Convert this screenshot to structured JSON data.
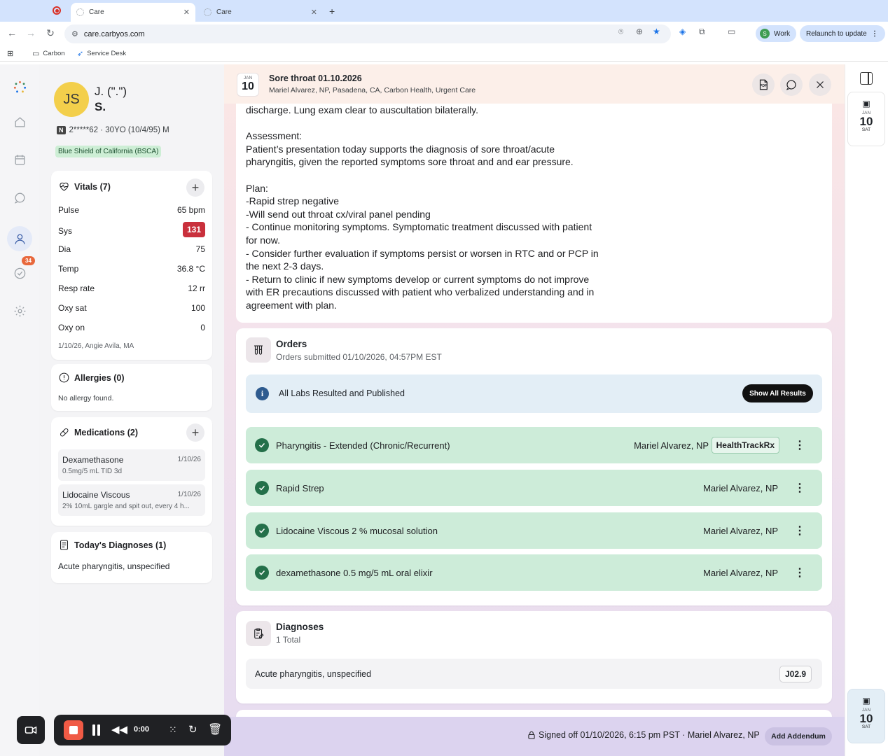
{
  "browser": {
    "tabs": [
      {
        "label": "Care"
      },
      {
        "label": "Care"
      }
    ],
    "url": "care.carbyos.com",
    "profile_initial": "S",
    "profile_label": "Work",
    "relaunch_label": "Relaunch to update",
    "bookmarks": [
      {
        "label": "Carbon"
      },
      {
        "label": "Service Desk"
      }
    ]
  },
  "sidebar": {
    "badge_count": "34"
  },
  "patient": {
    "initials": "JS",
    "name_line1": "J. (\".\")",
    "name_line2": "S.",
    "id_badge": "N",
    "id_line": "2*****62 · 30YO (10/4/95) M",
    "insurance": "Blue Shield of California (BSCA)"
  },
  "vitals": {
    "title": "Vitals (7)",
    "rows": [
      {
        "label": "Pulse",
        "value": "65 bpm"
      },
      {
        "label": "Sys",
        "value": "131"
      },
      {
        "label": "Dia",
        "value": "75"
      },
      {
        "label": "Temp",
        "value": "36.8 °C"
      },
      {
        "label": "Resp rate",
        "value": "12 rr"
      },
      {
        "label": "Oxy sat",
        "value": "100"
      },
      {
        "label": "Oxy on",
        "value": "0"
      }
    ],
    "footer": "1/10/26, Angie Avila, MA"
  },
  "allergies": {
    "title": "Allergies (0)",
    "empty": "No allergy found."
  },
  "medications": {
    "title": "Medications (2)",
    "items": [
      {
        "name": "Dexamethasone",
        "date": "1/10/26",
        "detail": "0.5mg/5 mL TID 3d"
      },
      {
        "name": "Lidocaine Viscous",
        "date": "1/10/26",
        "detail": "2% 10mL gargle and spit out, every 4 h..."
      }
    ]
  },
  "diagnoses_today": {
    "title": "Today's Diagnoses (1)",
    "item": "Acute pharyngitis, unspecified"
  },
  "encounter": {
    "month": "JAN",
    "day": "10",
    "title": "Sore throat 01.10.2026",
    "subtitle": "Mariel Alvarez, NP, Pasadena, CA, Carbon Health, Urgent Care",
    "pdf_label": "PDF"
  },
  "note": {
    "lines": [
      "discharge. Lung exam clear to auscultation bilaterally.",
      "",
      "Assessment:",
      "Patient’s presentation today supports the diagnosis of sore throat/acute",
      "pharyngitis, given the reported symptoms sore throat and and ear pressure.",
      "",
      "Plan:",
      "-Rapid strep negative",
      "-Will send out throat cx/viral panel pending",
      "- Continue monitoring symptoms. Symptomatic treatment discussed with patient",
      "for now.",
      "- Consider further evaluation if symptoms persist or worsen in RTC and or PCP in",
      "the next 2-3 days.",
      "- Return to clinic if new symptoms develop or current symptoms do not improve",
      "with ER precautions discussed with patient who verbalized understanding and in",
      "agreement with plan."
    ]
  },
  "orders": {
    "title": "Orders",
    "subtitle": "Orders submitted 01/10/2026, 04:57PM EST",
    "banner": "All Labs Resulted and Published",
    "show_all": "Show All Results",
    "items": [
      {
        "name": "Pharyngitis - Extended (Chronic/Recurrent)",
        "provider": "Mariel Alvarez, NP",
        "tag": "HealthTrackRx"
      },
      {
        "name": "Rapid Strep",
        "provider": "Mariel Alvarez, NP"
      },
      {
        "name": "Lidocaine Viscous 2 % mucosal solution",
        "provider": "Mariel Alvarez, NP"
      },
      {
        "name": "dexamethasone 0.5 mg/5 mL oral elixir",
        "provider": "Mariel Alvarez, NP"
      }
    ]
  },
  "diagnoses": {
    "title": "Diagnoses",
    "subtitle": "1 Total",
    "item": "Acute pharyngitis, unspecified",
    "code": "J02.9"
  },
  "footer": {
    "signed": "Signed off 01/10/2026, 6:15 pm PST · Mariel Alvarez, NP",
    "addendum": "Add Addendum"
  },
  "right_rail": {
    "card1": {
      "month": "JAN",
      "day": "10",
      "weekday": "SAT"
    },
    "card2": {
      "month": "JAN",
      "day": "10",
      "weekday": "SAT"
    }
  },
  "recorder": {
    "time": "0:00"
  },
  "colors": {
    "accent_dark": "#202124",
    "success": "#24704a",
    "alert": "#c9303c",
    "avatar": "#f3cf4b"
  }
}
